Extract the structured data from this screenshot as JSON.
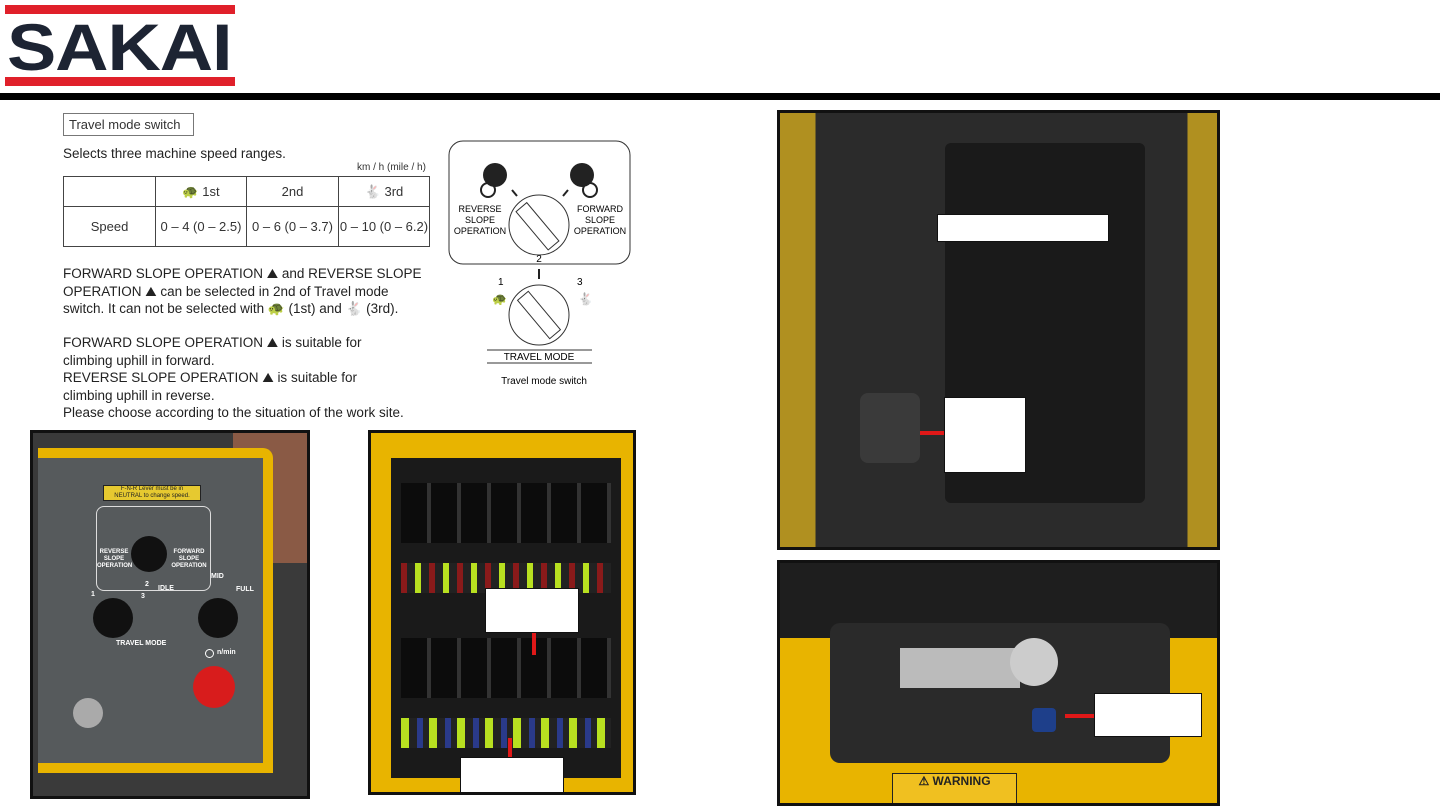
{
  "logo": {
    "text": "SAKAI",
    "colors": {
      "bars": "#e0202a",
      "text": "#1d2433"
    }
  },
  "manual": {
    "section_title": "Travel mode switch",
    "intro": "Selects three machine speed ranges.",
    "units": "km / h (mile / h)",
    "table": {
      "headers": [
        "",
        "1st",
        "2nd",
        "3rd"
      ],
      "header_icons": [
        "",
        "turtle-icon",
        "",
        "rabbit-icon"
      ],
      "rows": [
        [
          "Speed",
          "0 – 4 (0 – 2.5)",
          "0 – 6 (0 – 3.7)",
          "0 – 10 (0 – 6.2)"
        ]
      ]
    },
    "para1": [
      "FORWARD SLOPE OPERATION",
      "and REVERSE SLOPE",
      "OPERATION",
      "can be selected in 2nd of Travel mode",
      "switch. It can not be selected with",
      "(1st) and",
      "(3rd)."
    ],
    "para2": [
      "FORWARD SLOPE OPERATION",
      "is suitable for",
      "climbing uphill in forward.",
      "REVERSE SLOPE OPERATION",
      "is suitable for",
      "climbing uphill in reverse.",
      "Please choose according to the situation of the work site."
    ],
    "diagram": {
      "reverse": [
        "REVERSE",
        "SLOPE",
        "OPERATION"
      ],
      "forward": [
        "FORWARD",
        "SLOPE",
        "OPERATION"
      ],
      "pos2": "2",
      "pos1": "1",
      "pos3": "3",
      "travel_mode": "TRAVEL MODE",
      "caption": "Travel mode switch"
    }
  },
  "photos": {
    "panel": {
      "sticker": [
        "F-N-R Lever must be in",
        "NEUTRAL to change speed."
      ],
      "reverse": "REVERSE SLOPE OPERATION",
      "forward": "FORWARD SLOPE OPERATION",
      "pos1": "1",
      "pos2": "2",
      "pos3": "3",
      "idle": "IDLE",
      "mid": "MID",
      "full": "FULL",
      "travel_mode": "TRAVEL MODE",
      "rpm": "n/min"
    },
    "valve": {
      "warning": "WARNING"
    }
  }
}
